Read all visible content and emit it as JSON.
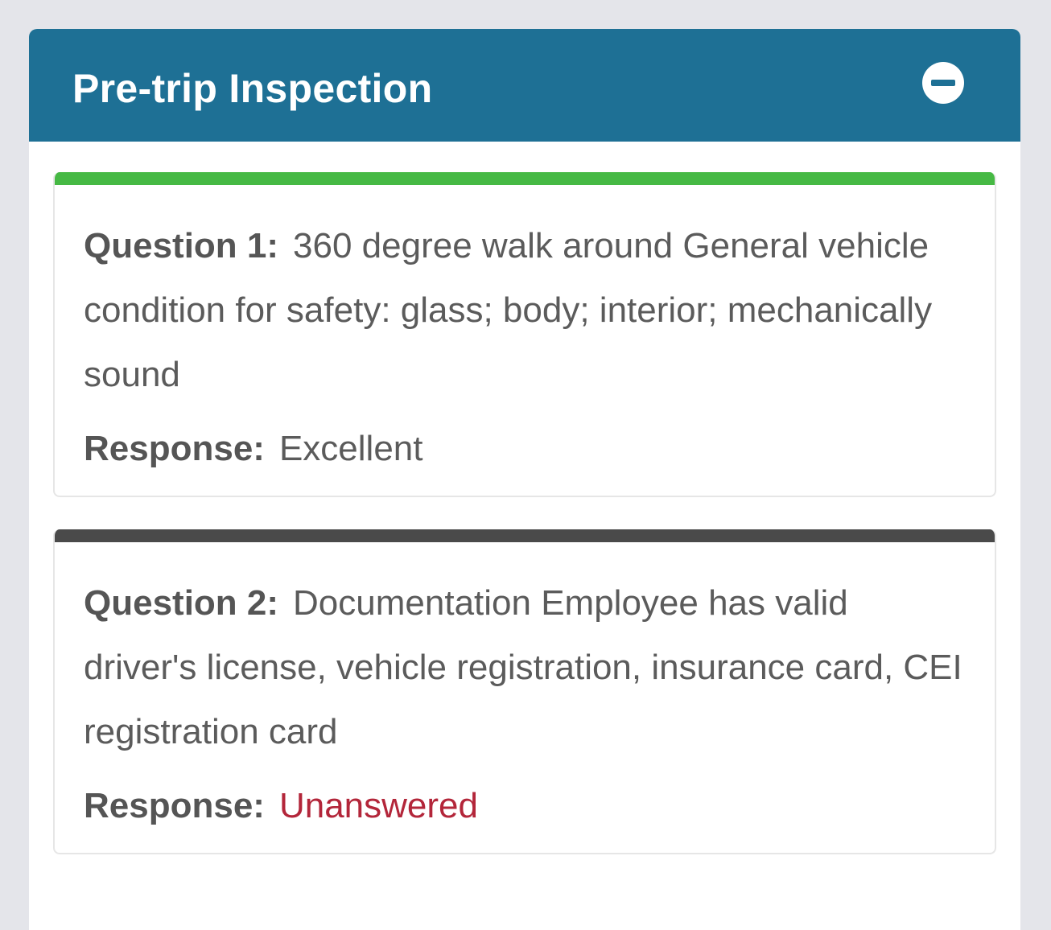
{
  "panel": {
    "title": "Pre-trip Inspection",
    "collapse_icon": "minus-circle-icon"
  },
  "colors": {
    "header": "#1e7095",
    "answered_bar": "#46b944",
    "unanswered_bar": "#4a4a4a",
    "unanswered_text": "#b3263a"
  },
  "questions": [
    {
      "label": "Question 1:",
      "text": "360 degree walk around General vehicle condition for safety: glass; body; interior; mechanically sound",
      "response_label": "Response:",
      "response": "Excellent"
    },
    {
      "label": "Question 2:",
      "text": "Documentation Employee has valid driver's license, vehicle registration, insurance card, CEI registration card",
      "response_label": "Response:",
      "response": "Unanswered"
    }
  ]
}
